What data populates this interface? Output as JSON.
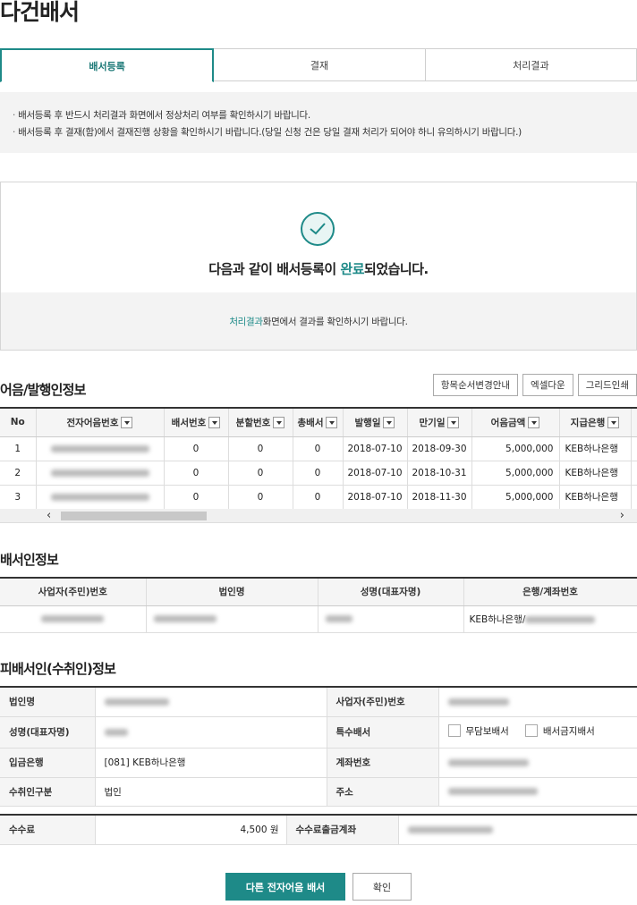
{
  "page": {
    "title": "다건배서"
  },
  "tabs": [
    {
      "label": "배서등록",
      "active": true
    },
    {
      "label": "결재",
      "active": false
    },
    {
      "label": "처리결과",
      "active": false
    }
  ],
  "notice": [
    "배서등록 후 반드시 처리결과 화면에서 정상처리 여부를 확인하시기 바랍니다.",
    "배서등록 후 결재(함)에서 결재진행 상황을 확인하시기 바랍니다.(당일 신청 건은 당일 결재 처리가 되어야 하니 유의하시기 바랍니다.)"
  ],
  "completion": {
    "msg_before": "다음과 같이 배서등록이 ",
    "msg_highlight": "완료",
    "msg_after": "되었습니다.",
    "sub_highlight": "처리결과",
    "sub_rest": "화면에서 결과를 확인하시기 바랍니다."
  },
  "bill_section": {
    "title": "어음/발행인정보",
    "buttons": [
      "항목순서변경안내",
      "엑셀다운",
      "그리드인쇄"
    ],
    "columns": [
      "No",
      "전자어음번호",
      "배서번호",
      "분할번호",
      "총배서",
      "발행일",
      "만기일",
      "어음금액",
      "지급은행"
    ],
    "rows": [
      {
        "no": "1",
        "endorse_no": "0",
        "split_no": "0",
        "total": "0",
        "issue": "2018-07-10",
        "due": "2018-09-30",
        "amount": "5,000,000",
        "bank": "KEB하나은행"
      },
      {
        "no": "2",
        "endorse_no": "0",
        "split_no": "0",
        "total": "0",
        "issue": "2018-07-10",
        "due": "2018-10-31",
        "amount": "5,000,000",
        "bank": "KEB하나은행"
      },
      {
        "no": "3",
        "endorse_no": "0",
        "split_no": "0",
        "total": "0",
        "issue": "2018-07-10",
        "due": "2018-11-30",
        "amount": "5,000,000",
        "bank": "KEB하나은행"
      }
    ]
  },
  "endorser": {
    "title": "배서인정보",
    "columns": [
      "사업자(주민)번호",
      "법인명",
      "성명(대표자명)",
      "은행/계좌번호"
    ],
    "bank_prefix": "KEB하나은행/"
  },
  "endorsee": {
    "title": "피배서인(수취인)정보",
    "corp_label": "법인명",
    "bizno_label": "사업자(주민)번호",
    "rep_label": "성명(대표자명)",
    "special_label": "특수배서",
    "special_opt1": "무담보배서",
    "special_opt2": "배서금지배서",
    "bank_label": "입금은행",
    "bank_value": "[081] KEB하나은행",
    "account_label": "계좌번호",
    "type_label": "수취인구분",
    "type_value": "법인",
    "addr_label": "주소"
  },
  "fee": {
    "label": "수수료",
    "value": "4,500 원",
    "account_label": "수수료출금계좌"
  },
  "actions": {
    "primary": "다른 전자어음 배서",
    "confirm": "확인"
  }
}
